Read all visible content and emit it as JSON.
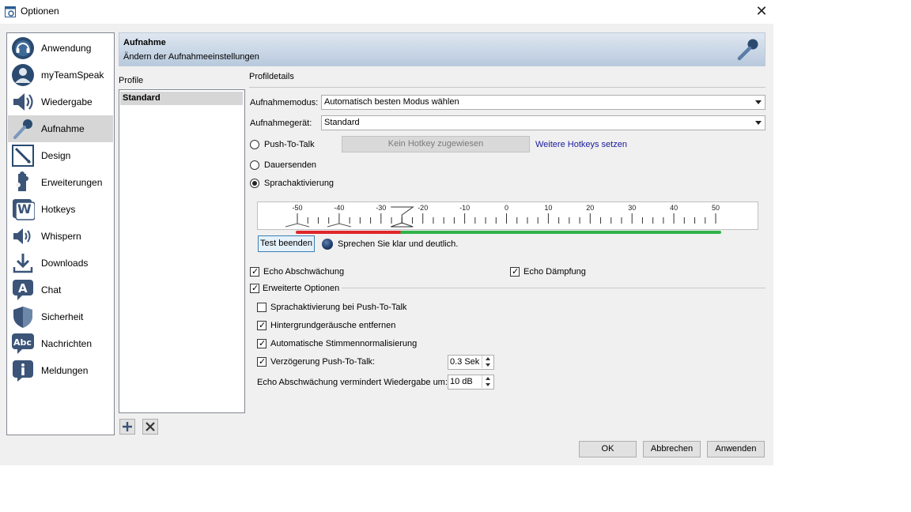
{
  "window": {
    "title": "Optionen"
  },
  "sidebar": {
    "items": [
      {
        "label": "Anwendung",
        "icon": "headset-icon"
      },
      {
        "label": "myTeamSpeak",
        "icon": "user-profile-icon"
      },
      {
        "label": "Wiedergabe",
        "icon": "speaker-icon"
      },
      {
        "label": "Aufnahme",
        "icon": "microphone-icon",
        "active": true
      },
      {
        "label": "Design",
        "icon": "design-pencil-icon"
      },
      {
        "label": "Erweiterungen",
        "icon": "puzzle-icon"
      },
      {
        "label": "Hotkeys",
        "icon": "hotkey-w-icon"
      },
      {
        "label": "Whispern",
        "icon": "whisper-speaker-icon"
      },
      {
        "label": "Downloads",
        "icon": "download-icon"
      },
      {
        "label": "Chat",
        "icon": "chat-bubble-icon"
      },
      {
        "label": "Sicherheit",
        "icon": "shield-icon"
      },
      {
        "label": "Nachrichten",
        "icon": "message-abc-icon"
      },
      {
        "label": "Meldungen",
        "icon": "info-icon"
      }
    ]
  },
  "header": {
    "title": "Aufnahme",
    "subtitle": "Ändern der Aufnahmeeinstellungen"
  },
  "profiles": {
    "label": "Profile",
    "items": [
      "Standard"
    ]
  },
  "details": {
    "label": "Profildetails",
    "mode_label": "Aufnahmemodus:",
    "mode_value": "Automatisch besten Modus wählen",
    "device_label": "Aufnahmegerät:",
    "device_value": "Standard",
    "push_to_talk": "Push-To-Talk",
    "hotkey_button": "Kein Hotkey zugewiesen",
    "more_hotkeys": "Weitere Hotkeys setzen",
    "continuous": "Dauersenden",
    "voice_activation": "Sprachaktivierung",
    "selected_mode": "Sprachaktivierung",
    "threshold_db": -25,
    "ruler": {
      "labels": [
        "-50",
        "-40",
        "-30",
        "-20",
        "-10",
        "0",
        "10",
        "20",
        "30",
        "40",
        "50"
      ],
      "min": -50,
      "max": 50
    },
    "test_button": "Test beenden",
    "test_hint": "Sprechen Sie klar und deutlich.",
    "echo_reduction": "Echo Abschwächung",
    "echo_damping": "Echo Dämpfung",
    "advanced": "Erweiterte Optionen",
    "voice_on_ptt": "Sprachaktivierung bei Push-To-Talk",
    "noise_removal": "Hintergrundgeräusche entfernen",
    "auto_normalize": "Automatische Stimmennormalisierung",
    "ptt_delay": "Verzögerung Push-To-Talk:",
    "ptt_delay_value": "0.3 Sek",
    "echo_reduce_playback": "Echo Abschwächung vermindert Wiedergabe um:",
    "echo_reduce_value": "10 dB"
  },
  "buttons": {
    "ok": "OK",
    "cancel": "Abbrechen",
    "apply": "Anwenden"
  },
  "colors": {
    "header_top": "#dfe7f1",
    "header_bottom": "#b8c9dd",
    "level_red": "#e0262b",
    "level_green": "#2fb24a",
    "link": "#1a1a9c"
  }
}
